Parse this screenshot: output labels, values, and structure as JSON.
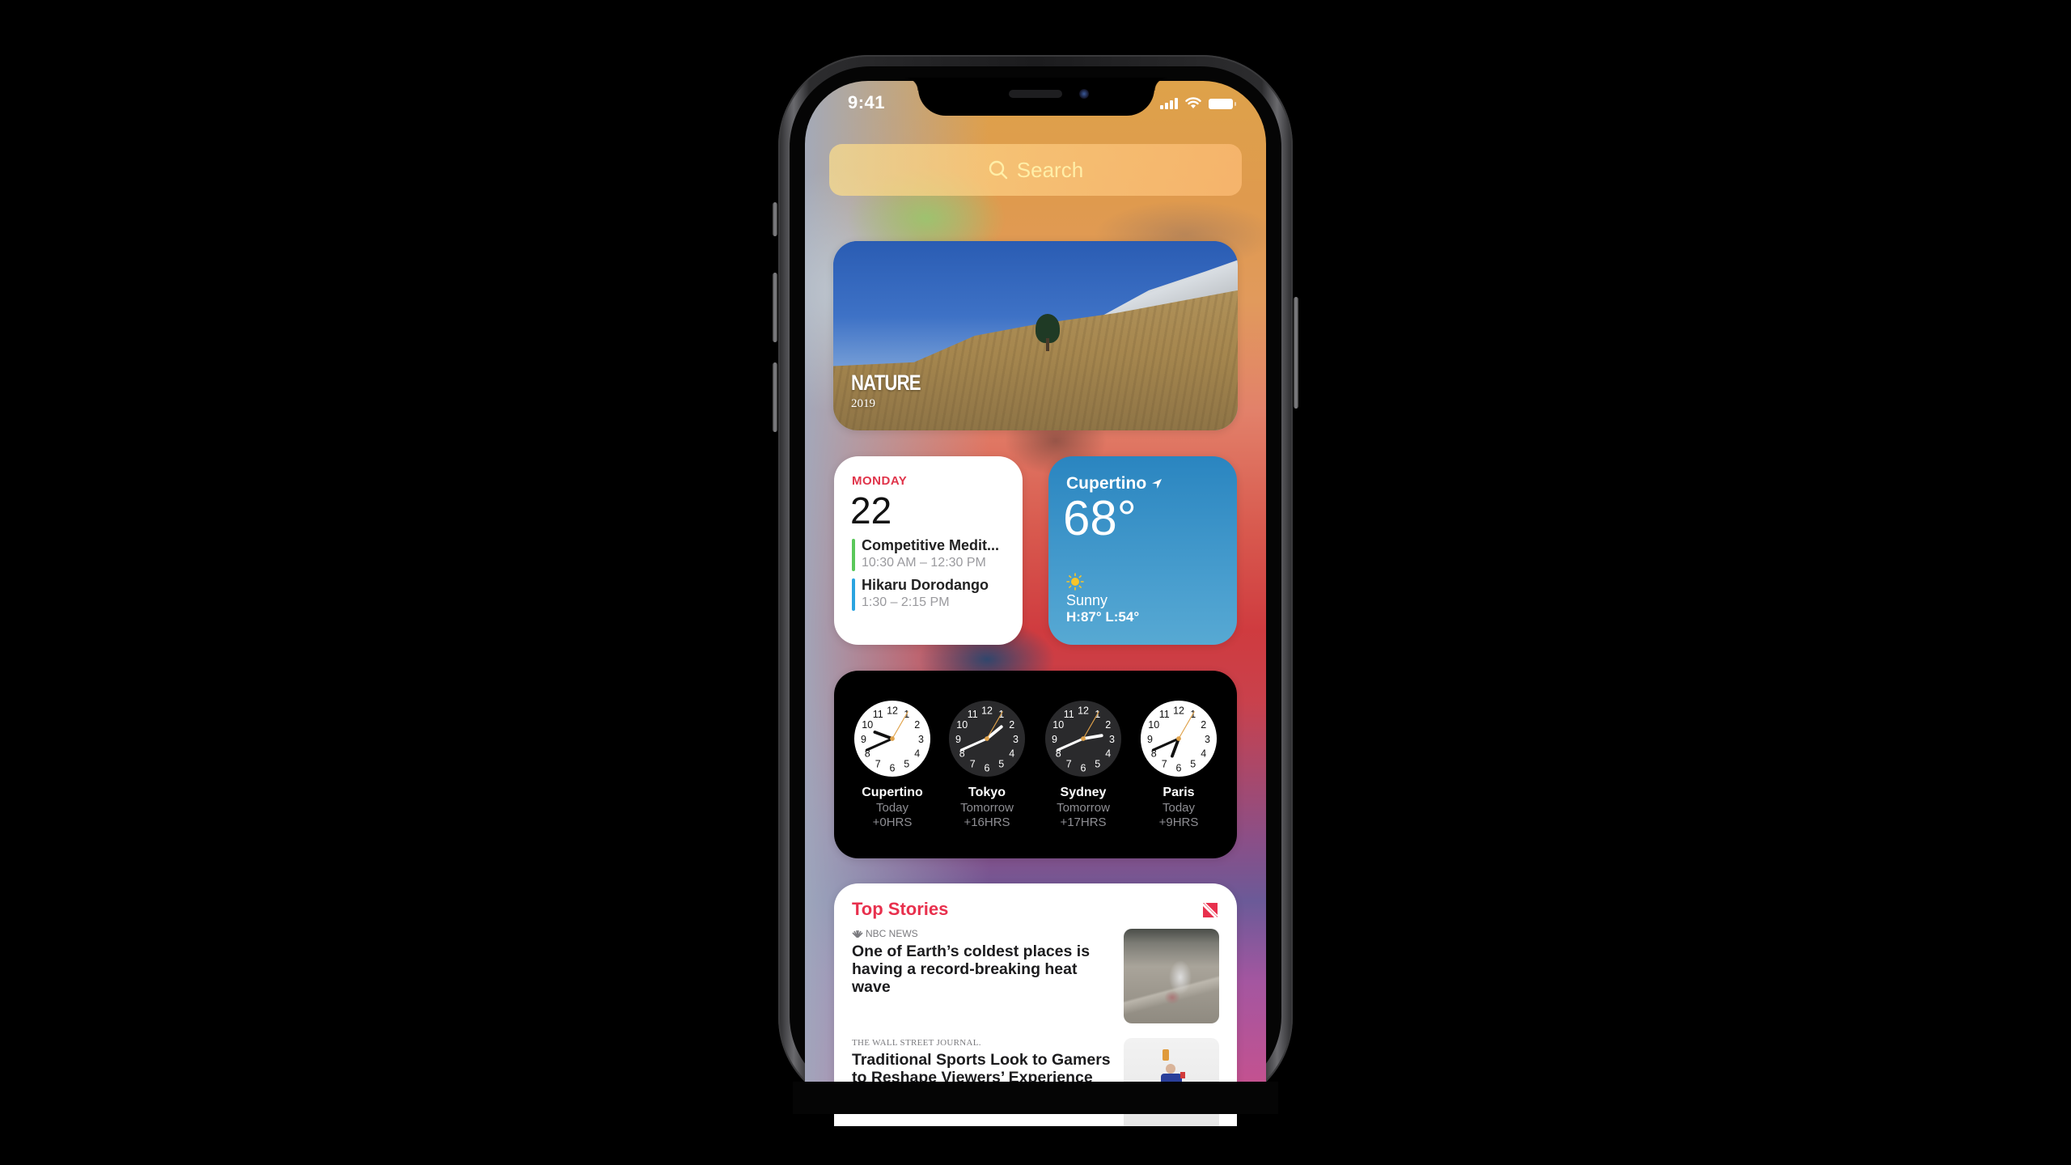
{
  "status_bar": {
    "time": "9:41",
    "icons": [
      "cellular-signal-icon",
      "wifi-icon",
      "battery-icon"
    ]
  },
  "search": {
    "placeholder": "Search",
    "icon": "search-icon"
  },
  "photos_widget": {
    "title": "NATURE",
    "year": "2019"
  },
  "calendar_widget": {
    "weekday": "MONDAY",
    "date": "22",
    "events": [
      {
        "title": "Competitive Medit...",
        "time": "10:30 AM – 12:30 PM",
        "color": "#5ac85a"
      },
      {
        "title": "Hikaru Dorodango",
        "time": "1:30 – 2:15 PM",
        "color": "#2aa4e0"
      }
    ],
    "accent": "#e0344a"
  },
  "weather_widget": {
    "city": "Cupertino",
    "location_icon": "location-arrow-icon",
    "temperature": "68°",
    "condition_icon": "sun-icon",
    "condition": "Sunny",
    "high_low": "H:87° L:54°"
  },
  "clock_widget": {
    "clocks": [
      {
        "city": "Cupertino",
        "day": "Today",
        "offset": "+0HRS",
        "time": "9:41",
        "theme": "light"
      },
      {
        "city": "Tokyo",
        "day": "Tomorrow",
        "offset": "+16HRS",
        "time": "1:41",
        "theme": "dark"
      },
      {
        "city": "Sydney",
        "day": "Tomorrow",
        "offset": "+17HRS",
        "time": "2:41",
        "theme": "dark"
      },
      {
        "city": "Paris",
        "day": "Today",
        "offset": "+9HRS",
        "time": "6:41",
        "theme": "light"
      }
    ]
  },
  "news_widget": {
    "heading": "Top Stories",
    "logo": "apple-news-icon",
    "accent": "#e8304d",
    "stories": [
      {
        "source": "NBC NEWS",
        "headline": "One of Earth’s coldest places is having a record-breaking heat wave"
      },
      {
        "source": "THE WALL STREET JOURNAL.",
        "headline": "Traditional Sports Look to Gamers to Reshape Viewers’ Experience"
      }
    ]
  }
}
